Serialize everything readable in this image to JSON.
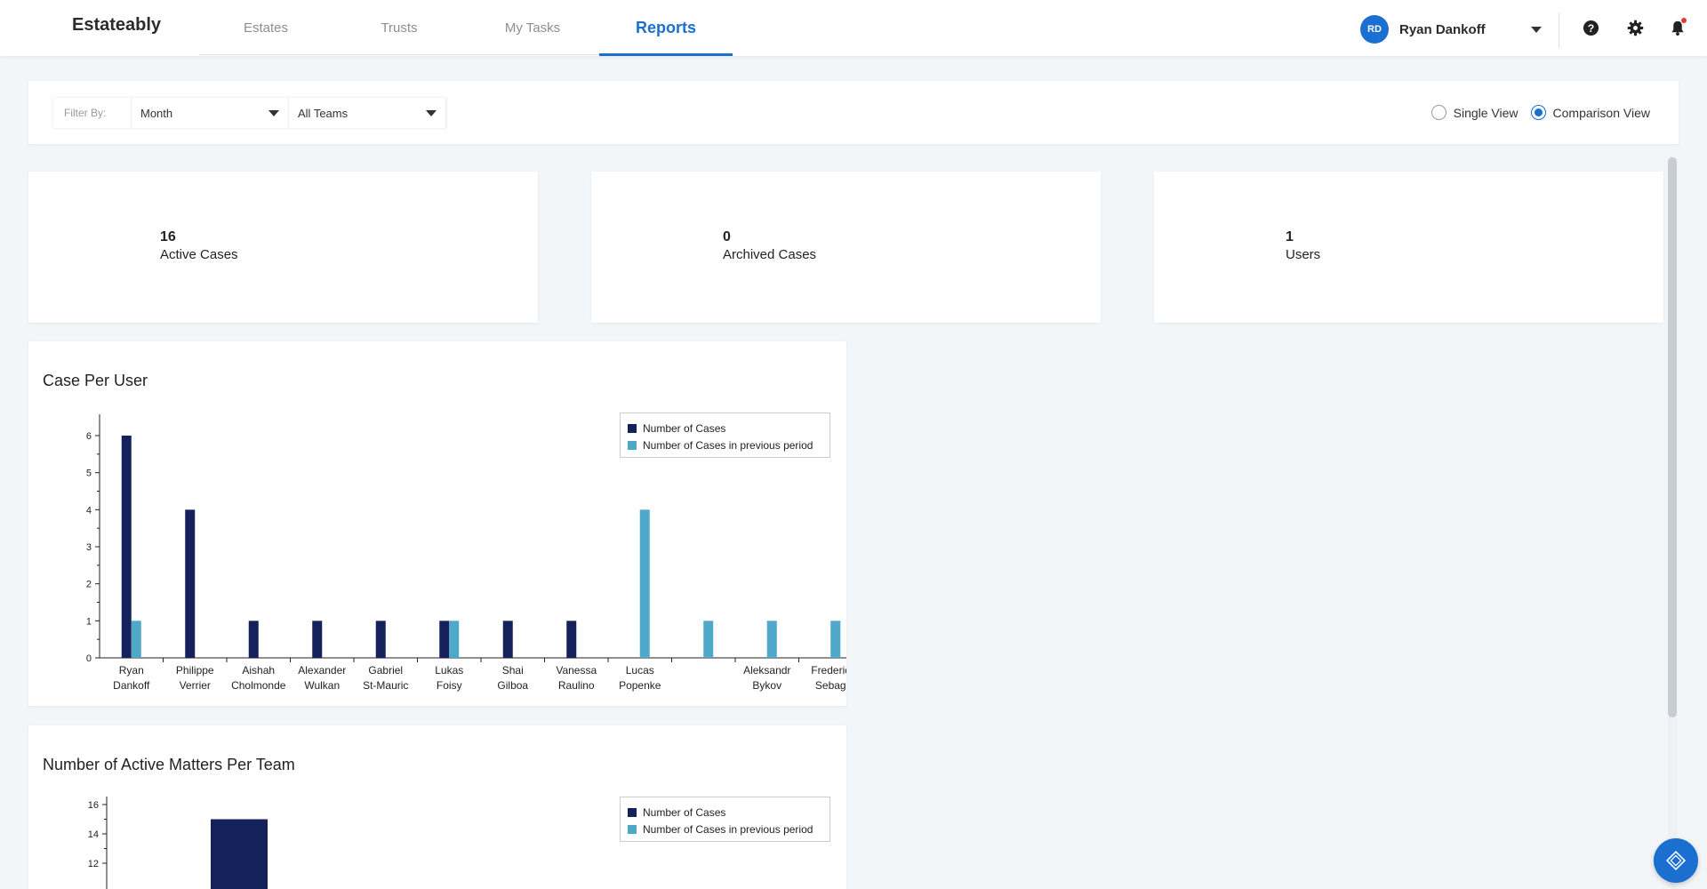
{
  "app": {
    "brand": "Estateably"
  },
  "nav": {
    "tabs": [
      {
        "label": "Estates",
        "active": false
      },
      {
        "label": "Trusts",
        "active": false
      },
      {
        "label": "My Tasks",
        "active": false
      },
      {
        "label": "Reports",
        "active": true
      }
    ]
  },
  "user": {
    "initials": "RD",
    "name": "Ryan Dankoff"
  },
  "filters": {
    "label": "Filter By:",
    "period": "Month",
    "team": "All Teams"
  },
  "view_toggle": {
    "single_label": "Single View",
    "comparison_label": "Comparison View",
    "selected": "comparison"
  },
  "stats": [
    {
      "value": "16",
      "label": "Active Cases"
    },
    {
      "value": "0",
      "label": "Archived Cases"
    },
    {
      "value": "1",
      "label": "Users"
    }
  ],
  "colors": {
    "accent": "#1a6fd0",
    "series_current": "#14215a",
    "series_previous": "#4fa8c8",
    "notification": "#e03a3a"
  },
  "chart_data": [
    {
      "type": "bar",
      "title": "Case Per User",
      "categories": [
        [
          "Ryan",
          "Dankoff"
        ],
        [
          "Philippe",
          "Verrier"
        ],
        [
          "Aishah",
          "Cholmonde"
        ],
        [
          "Alexander",
          "Wulkan"
        ],
        [
          "Gabriel",
          "St-Mauric"
        ],
        [
          "Lukas",
          "Foisy"
        ],
        [
          "Shai",
          "Gilboa"
        ],
        [
          "Vanessa",
          "Raulino"
        ],
        [
          "Lucas",
          "Popenke"
        ],
        [
          "",
          ""
        ],
        [
          "Aleksandr",
          "Bykov"
        ],
        [
          "Frederic",
          "Sebag"
        ]
      ],
      "series": [
        {
          "name": "Number of Cases",
          "values": [
            6,
            4,
            1,
            1,
            1,
            1,
            1,
            1,
            0,
            0,
            0,
            0
          ]
        },
        {
          "name": "Number of Cases in previous period",
          "values": [
            1,
            0,
            0,
            0,
            0,
            1,
            0,
            0,
            4,
            1,
            1,
            1
          ]
        }
      ],
      "ylim": [
        0,
        6.5
      ],
      "yticks": [
        0,
        1,
        2,
        3,
        4,
        5,
        6
      ],
      "legend": "top-right",
      "grid": false
    },
    {
      "type": "bar",
      "title": "Number of Active Matters Per Team",
      "categories": [
        ""
      ],
      "series": [
        {
          "name": "Number of Cases",
          "values": [
            15
          ]
        },
        {
          "name": "Number of Cases in previous period",
          "values": [
            0
          ]
        }
      ],
      "yticks": [
        12,
        14,
        16
      ],
      "legend": "top-right",
      "grid": false
    }
  ]
}
